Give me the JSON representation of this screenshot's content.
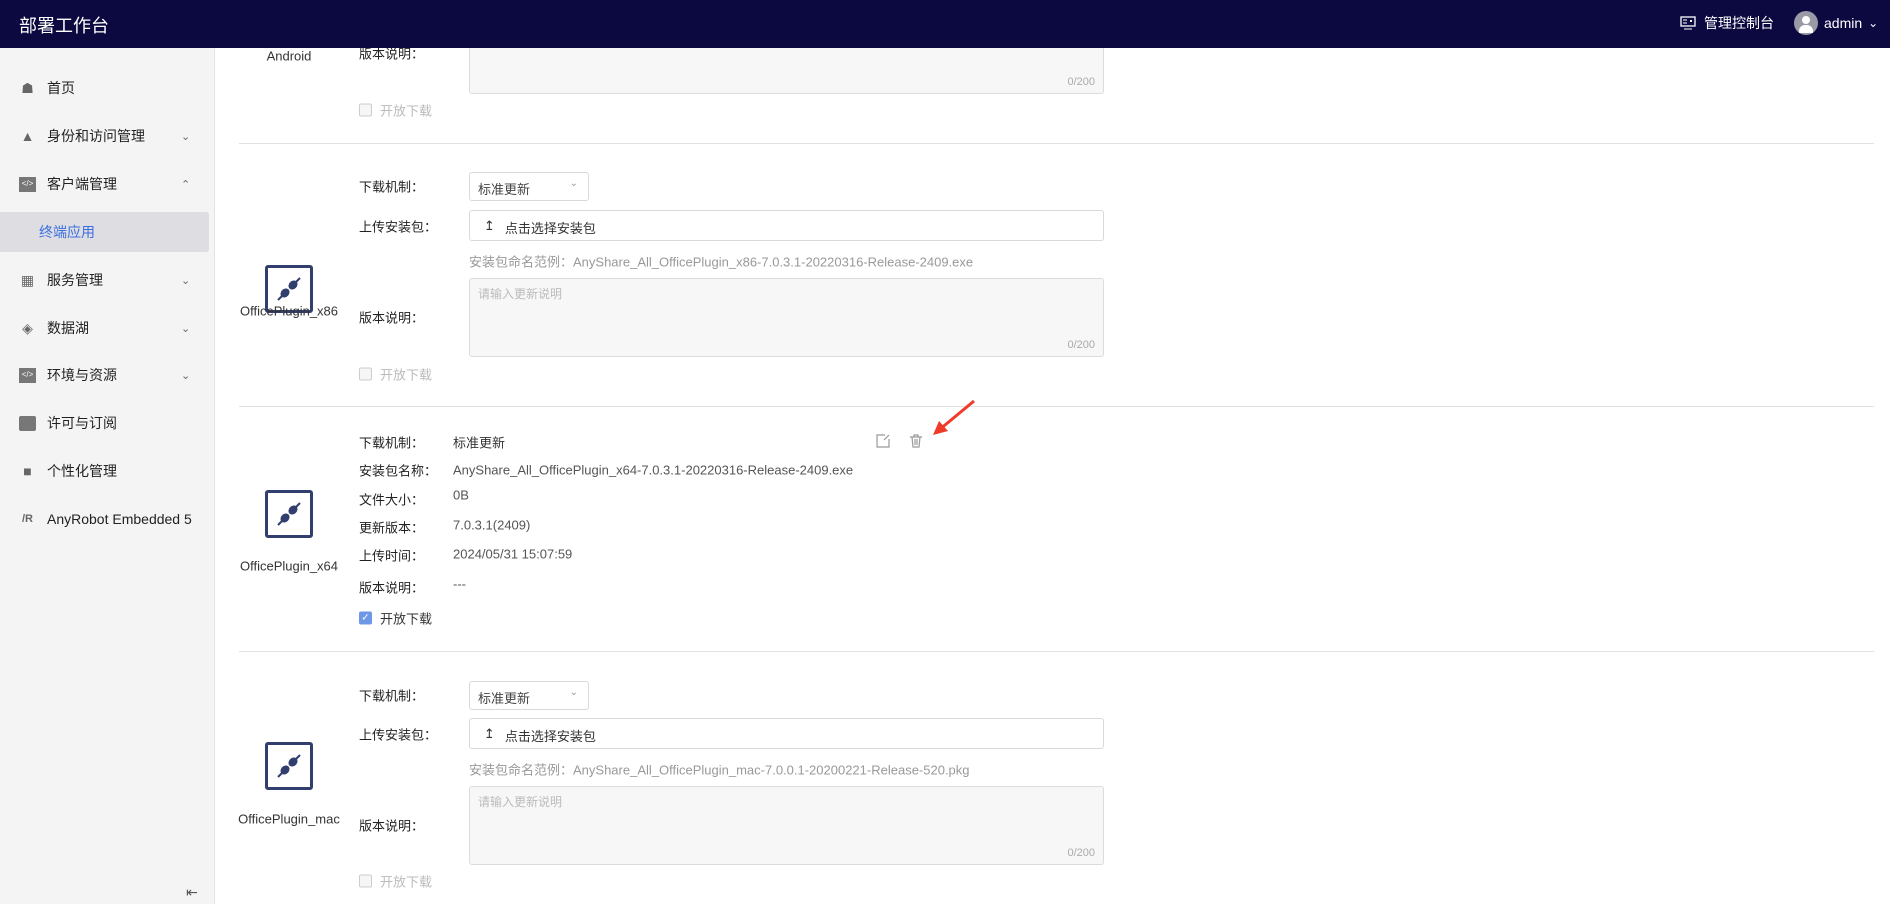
{
  "header": {
    "title": "部署工作台",
    "console_label": "管理控制台",
    "user": "admin"
  },
  "sidebar": {
    "items": [
      {
        "label": "首页",
        "icon": "home-icon"
      },
      {
        "label": "身份和访问管理",
        "icon": "org-icon",
        "chevron": "down"
      },
      {
        "label": "客户端管理",
        "icon": "code-icon",
        "chevron": "up"
      },
      {
        "label": "终端应用",
        "active": true
      },
      {
        "label": "服务管理",
        "icon": "layout-icon",
        "chevron": "down"
      },
      {
        "label": "数据湖",
        "icon": "datalake-icon",
        "chevron": "down"
      },
      {
        "label": "环境与资源",
        "icon": "code-icon",
        "chevron": "down"
      },
      {
        "label": "许可与订阅",
        "icon": "license-icon"
      },
      {
        "label": "个性化管理",
        "icon": "shirt-icon"
      },
      {
        "label": "AnyRobot Embedded 5",
        "icon": "anyrobot-icon"
      }
    ]
  },
  "labels": {
    "mechanism": "下载机制：",
    "upload": "上传安装包：",
    "notes": "版本说明：",
    "package_name": "安装包名称：",
    "file_size": "文件大小：",
    "version": "更新版本：",
    "upload_time": "上传时间：",
    "open_download": "开放下载",
    "upload_button": "点击选择安装包",
    "notes_placeholder": "请输入更新说明",
    "counter": "0/200"
  },
  "sections": [
    {
      "name": "Android",
      "open_download": false
    },
    {
      "name": "OfficePlugin_x86",
      "mechanism": "标准更新",
      "hint": "安装包命名范例：AnyShare_All_OfficePlugin_x86-7.0.3.1-20220316-Release-2409.exe",
      "open_download": false
    },
    {
      "name": "OfficePlugin_x64",
      "mechanism": "标准更新",
      "package_name": "AnyShare_All_OfficePlugin_x64-7.0.3.1-20220316-Release-2409.exe",
      "file_size": "0B",
      "version": "7.0.3.1(2409)",
      "upload_time": "2024/05/31 15:07:59",
      "notes": "---",
      "open_download": true
    },
    {
      "name": "OfficePlugin_mac",
      "mechanism": "标准更新",
      "hint": "安装包命名范例：AnyShare_All_OfficePlugin_mac-7.0.0.1-20200221-Release-520.pkg",
      "open_download": false
    }
  ],
  "colors": {
    "header_bg": "#0c0840",
    "active_link": "#3a6fe0",
    "annotation_arrow": "#f03a2a",
    "icon": "#323f6e"
  }
}
